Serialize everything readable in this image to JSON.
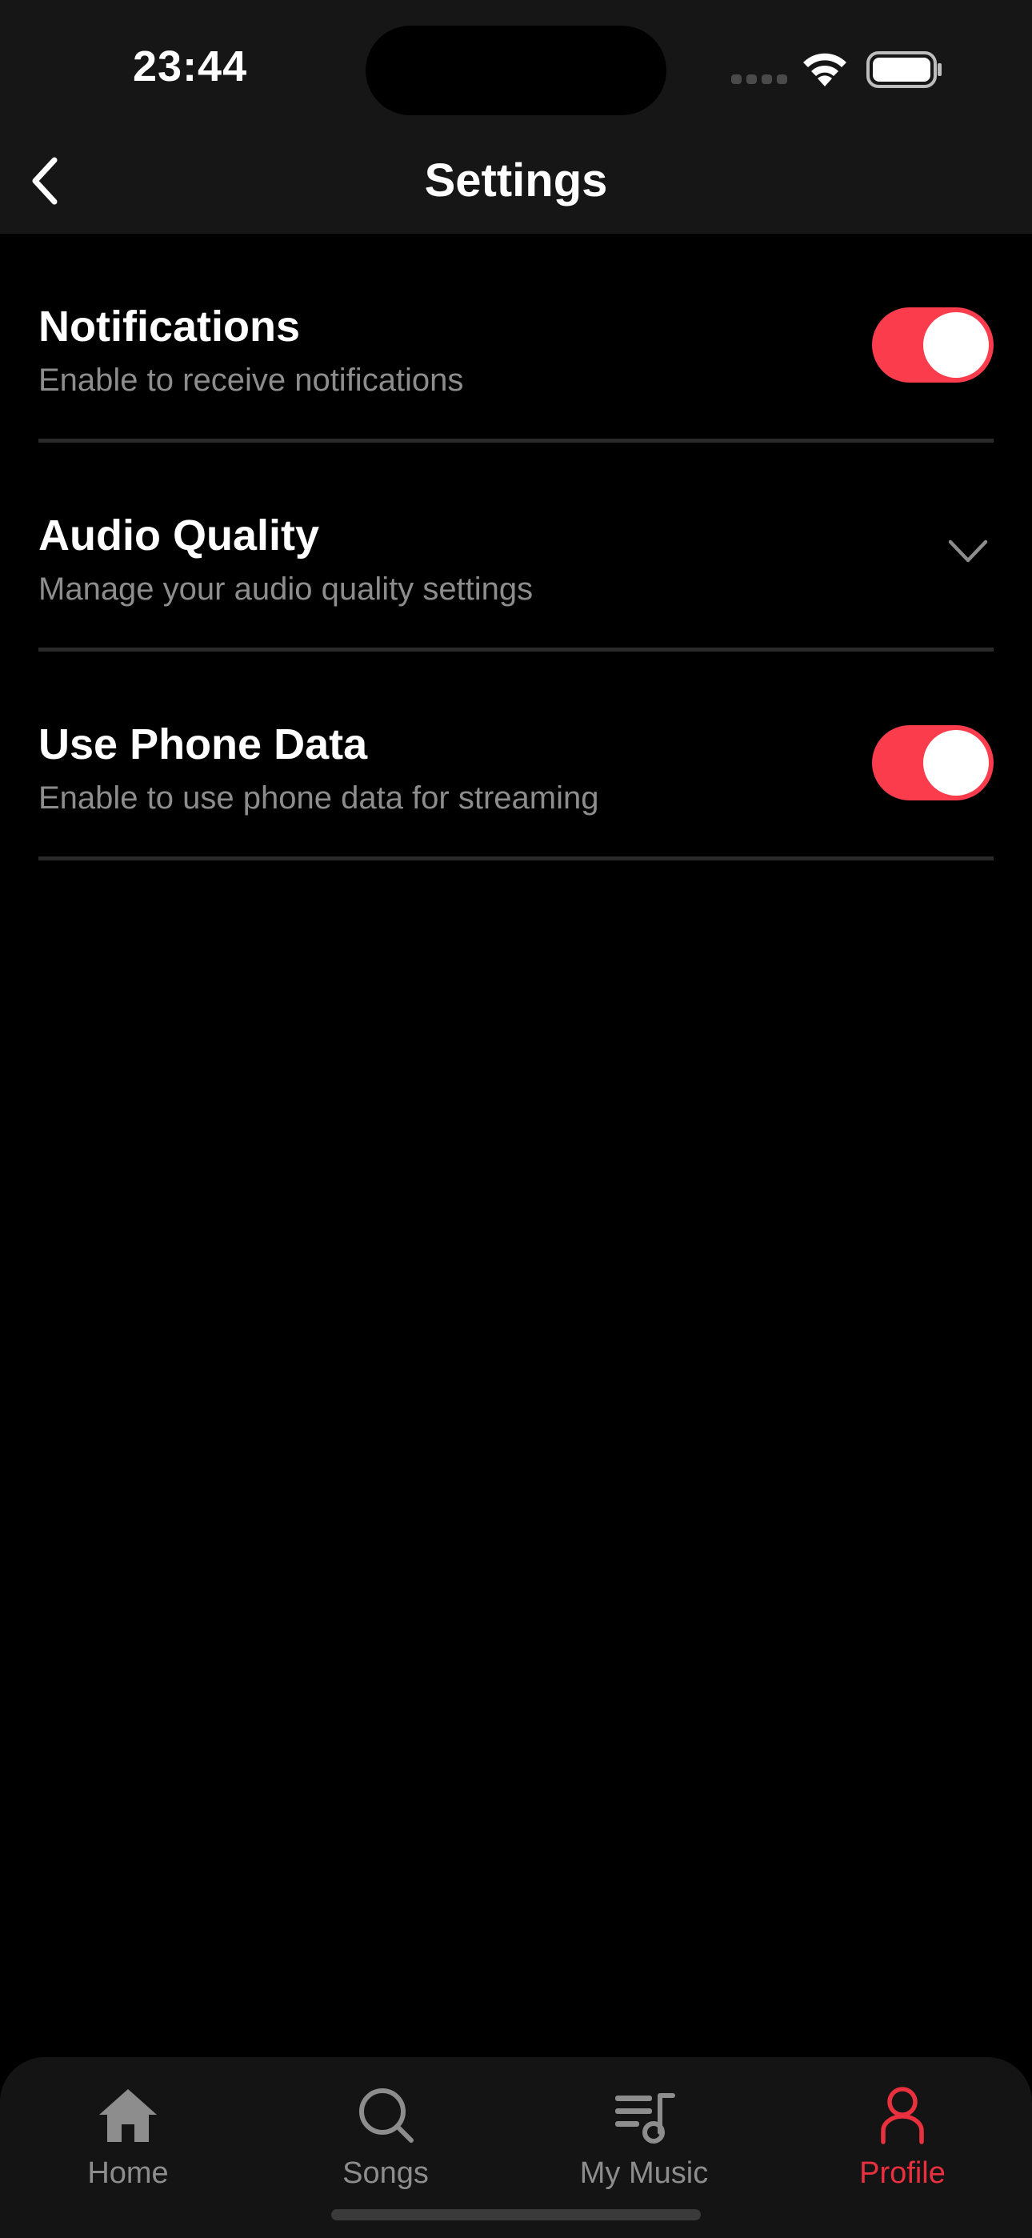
{
  "status_bar": {
    "time": "23:44"
  },
  "header": {
    "title": "Settings",
    "back_icon": "chevron-left-icon"
  },
  "settings": [
    {
      "title": "Notifications",
      "subtitle": "Enable to receive notifications",
      "control": "toggle",
      "enabled": true
    },
    {
      "title": "Audio Quality",
      "subtitle": "Manage your audio quality settings",
      "control": "chevron-down-icon"
    },
    {
      "title": "Use Phone Data",
      "subtitle": "Enable to use phone data for streaming",
      "control": "toggle",
      "enabled": true
    }
  ],
  "tab_bar": {
    "items": [
      {
        "label": "Home",
        "icon": "home-icon",
        "active": false
      },
      {
        "label": "Songs",
        "icon": "search-icon",
        "active": false
      },
      {
        "label": "My Music",
        "icon": "playlist-icon",
        "active": false
      },
      {
        "label": "Profile",
        "icon": "profile-icon",
        "active": true
      }
    ]
  },
  "colors": {
    "accent": "#fa3c4c",
    "active_tab": "#e9303f",
    "background": "#000000",
    "header_background": "#161616",
    "secondary_text": "#8d8d8d"
  }
}
